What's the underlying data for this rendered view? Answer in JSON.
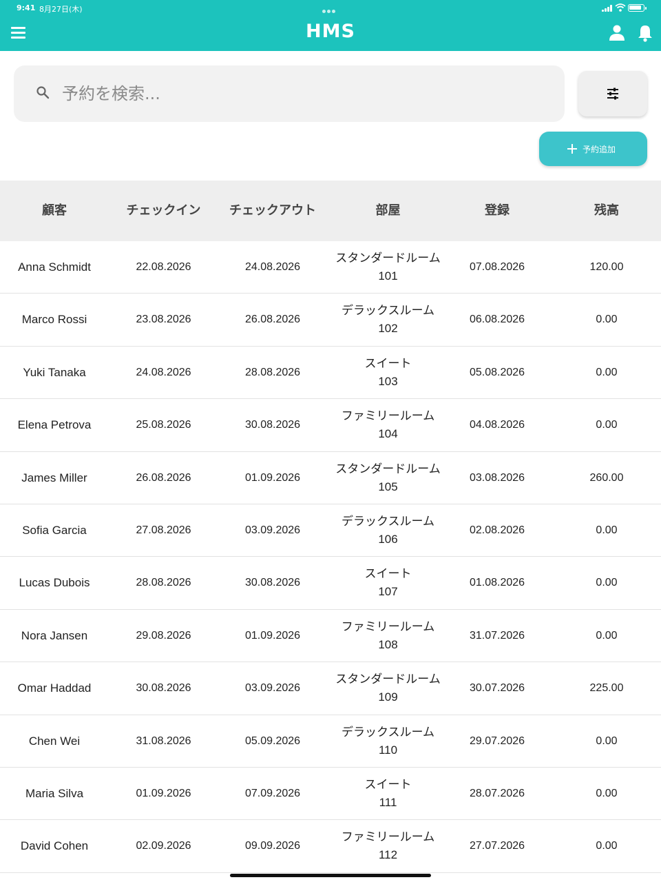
{
  "status_bar": {
    "time": "9:41",
    "date": "8月27日(木)"
  },
  "app": {
    "title": "HMS",
    "primary_color": "#1cc3bd",
    "accent_button_color": "#3dc4cb"
  },
  "search": {
    "placeholder": "予約を検索..."
  },
  "actions": {
    "add_reservation_label": "予約追加"
  },
  "table": {
    "headers": [
      "顧客",
      "チェックイン",
      "チェックアウト",
      "部屋",
      "登録",
      "残高"
    ],
    "rows": [
      {
        "customer": "Anna Schmidt",
        "checkin": "22.08.2026",
        "checkout": "24.08.2026",
        "room_type": "スタンダードルーム",
        "room_number": "101",
        "registered": "07.08.2026",
        "balance": "120.00"
      },
      {
        "customer": "Marco Rossi",
        "checkin": "23.08.2026",
        "checkout": "26.08.2026",
        "room_type": "デラックスルーム",
        "room_number": "102",
        "registered": "06.08.2026",
        "balance": "0.00"
      },
      {
        "customer": "Yuki Tanaka",
        "checkin": "24.08.2026",
        "checkout": "28.08.2026",
        "room_type": "スイート",
        "room_number": "103",
        "registered": "05.08.2026",
        "balance": "0.00"
      },
      {
        "customer": "Elena Petrova",
        "checkin": "25.08.2026",
        "checkout": "30.08.2026",
        "room_type": "ファミリールーム",
        "room_number": "104",
        "registered": "04.08.2026",
        "balance": "0.00"
      },
      {
        "customer": "James Miller",
        "checkin": "26.08.2026",
        "checkout": "01.09.2026",
        "room_type": "スタンダードルーム",
        "room_number": "105",
        "registered": "03.08.2026",
        "balance": "260.00"
      },
      {
        "customer": "Sofia Garcia",
        "checkin": "27.08.2026",
        "checkout": "03.09.2026",
        "room_type": "デラックスルーム",
        "room_number": "106",
        "registered": "02.08.2026",
        "balance": "0.00"
      },
      {
        "customer": "Lucas Dubois",
        "checkin": "28.08.2026",
        "checkout": "30.08.2026",
        "room_type": "スイート",
        "room_number": "107",
        "registered": "01.08.2026",
        "balance": "0.00"
      },
      {
        "customer": "Nora Jansen",
        "checkin": "29.08.2026",
        "checkout": "01.09.2026",
        "room_type": "ファミリールーム",
        "room_number": "108",
        "registered": "31.07.2026",
        "balance": "0.00"
      },
      {
        "customer": "Omar Haddad",
        "checkin": "30.08.2026",
        "checkout": "03.09.2026",
        "room_type": "スタンダードルーム",
        "room_number": "109",
        "registered": "30.07.2026",
        "balance": "225.00"
      },
      {
        "customer": "Chen Wei",
        "checkin": "31.08.2026",
        "checkout": "05.09.2026",
        "room_type": "デラックスルーム",
        "room_number": "110",
        "registered": "29.07.2026",
        "balance": "0.00"
      },
      {
        "customer": "Maria Silva",
        "checkin": "01.09.2026",
        "checkout": "07.09.2026",
        "room_type": "スイート",
        "room_number": "111",
        "registered": "28.07.2026",
        "balance": "0.00"
      },
      {
        "customer": "David Cohen",
        "checkin": "02.09.2026",
        "checkout": "09.09.2026",
        "room_type": "ファミリールーム",
        "room_number": "112",
        "registered": "27.07.2026",
        "balance": "0.00"
      }
    ]
  },
  "icons": {
    "menu": "hamburger-menu-icon",
    "profile": "person-icon",
    "notifications": "bell-icon",
    "search": "search-icon",
    "filter": "sliders-icon",
    "add": "plus-icon"
  }
}
